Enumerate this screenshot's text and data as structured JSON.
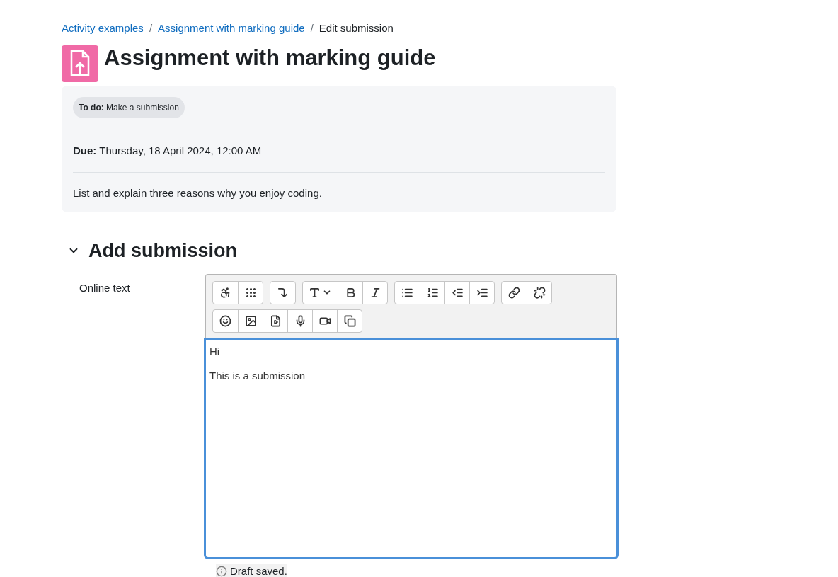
{
  "breadcrumb": {
    "separator": "/",
    "items": [
      {
        "label": "Activity examples",
        "kind": "link"
      },
      {
        "label": "Assignment with marking guide",
        "kind": "link"
      },
      {
        "label": "Edit submission",
        "kind": "current"
      }
    ]
  },
  "title": "Assignment with marking guide",
  "info": {
    "badge": "**To do:** Make a submission",
    "due": "**Due:** Thursday, 18 April 2024, 12:00 AM",
    "description": "List and explain three reasons why you enjoy coding."
  },
  "section": {
    "title": "Add submission",
    "expanded": true
  },
  "field": {
    "label": "Online text",
    "focused": true,
    "paragraphs": [
      "Hi",
      "This is a submission"
    ]
  },
  "status": "Draft saved."
}
